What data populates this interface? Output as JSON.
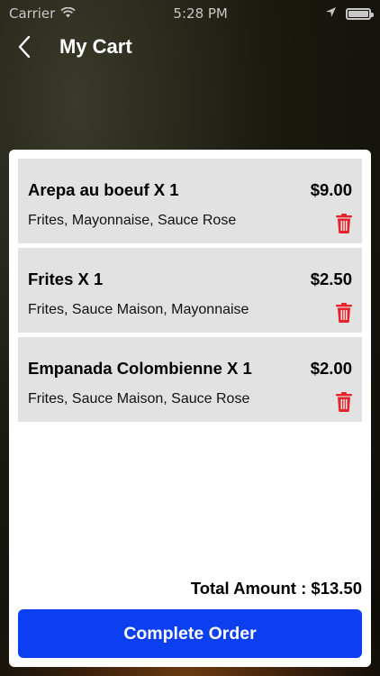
{
  "status_bar": {
    "carrier": "Carrier",
    "time": "5:28 PM"
  },
  "nav": {
    "title": "My Cart"
  },
  "cart": {
    "items": [
      {
        "name": "Arepa au boeuf X 1",
        "price": "$9.00",
        "options": "Frites, Mayonnaise, Sauce Rose"
      },
      {
        "name": "Frites X 1",
        "price": "$2.50",
        "options": "Frites, Sauce Maison, Mayonnaise"
      },
      {
        "name": "Empanada Colombienne X 1",
        "price": "$2.00",
        "options": "Frites, Sauce Maison, Sauce Rose"
      }
    ],
    "total_label": "Total Amount : ",
    "total_value": "$13.50",
    "complete_button": "Complete Order"
  },
  "colors": {
    "primary_button": "#0b3fef",
    "delete_icon": "#e8222b",
    "item_background": "#e2e2e2"
  },
  "icons": {
    "back": "chevron-left-icon",
    "delete": "trash-icon",
    "wifi": "wifi-icon",
    "location": "location-arrow-icon",
    "battery": "battery-icon"
  }
}
